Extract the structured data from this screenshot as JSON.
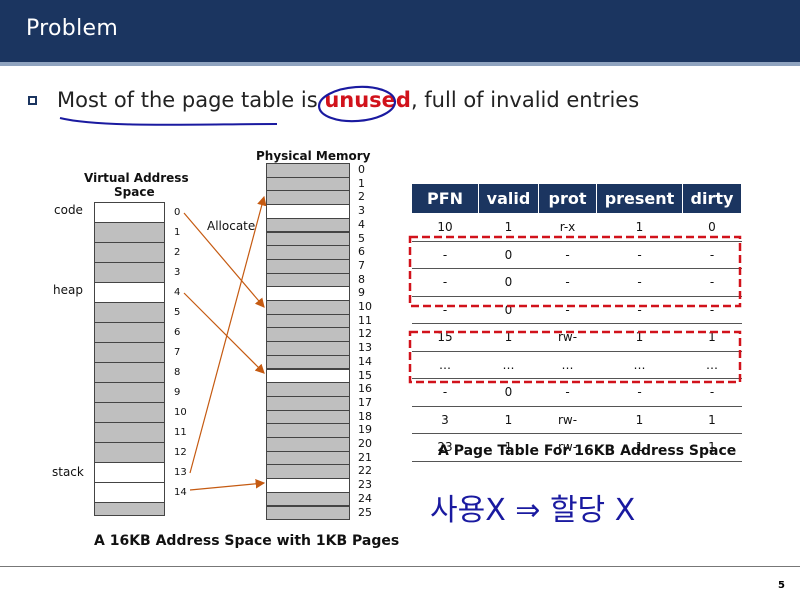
{
  "slide": {
    "title": "Problem",
    "page_number": "5"
  },
  "bullet": {
    "pre": "Most of the page table is ",
    "highlight": "unused",
    "post": ", full of invalid entries"
  },
  "virtual": {
    "title_line1": "Virtual Address",
    "title_line2": "Space",
    "labels": {
      "code": "code",
      "heap": "heap",
      "stack": "stack",
      "allocate": "Allocate"
    },
    "numbers": [
      "0",
      "1",
      "2",
      "3",
      "4",
      "5",
      "6",
      "7",
      "8",
      "9",
      "10",
      "11",
      "12",
      "13",
      "14"
    ],
    "caption": "A 16KB Address Space with 1KB Pages"
  },
  "physical": {
    "title": "Physical Memory",
    "numbers": [
      "0",
      "1",
      "2",
      "3",
      "4",
      "5",
      "6",
      "7",
      "8",
      "9",
      "10",
      "11",
      "12",
      "13",
      "14",
      "15",
      "16",
      "17",
      "18",
      "19",
      "20",
      "21",
      "22",
      "23",
      "24",
      "25"
    ]
  },
  "page_table": {
    "headers": [
      "PFN",
      "valid",
      "prot",
      "present",
      "dirty"
    ],
    "rows": [
      [
        "10",
        "1",
        "r-x",
        "1",
        "0"
      ],
      [
        "-",
        "0",
        "-",
        "-",
        "-"
      ],
      [
        "-",
        "0",
        "-",
        "-",
        "-"
      ],
      [
        "-",
        "0",
        "-",
        "-",
        "-"
      ],
      [
        "15",
        "1",
        "rw-",
        "1",
        "1"
      ],
      [
        "…",
        "…",
        "…",
        "…",
        "…"
      ],
      [
        "-",
        "0",
        "-",
        "-",
        "-"
      ],
      [
        "3",
        "1",
        "rw-",
        "1",
        "1"
      ],
      [
        "23",
        "1",
        "rw-",
        "1",
        "1"
      ]
    ],
    "caption": "A Page Table For 16KB Address Space"
  },
  "annotation": {
    "handwritten": "사용X ⇒ 할당 X"
  },
  "colors": {
    "header_bg": "#1b3560",
    "highlight": "#d1121b",
    "arrow": "#c55a11",
    "dashed_box": "#d1121b",
    "ink": "#1a1aa0",
    "gray_cell": "#bfbfbf"
  }
}
